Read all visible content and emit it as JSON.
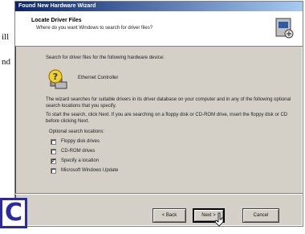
{
  "page_fragments": [
    "ill",
    "nd"
  ],
  "dialog": {
    "title": "Found New Hardware Wizard",
    "header_title": "Locate Driver Files",
    "header_subtitle": "Where do you want Windows to search for driver files?",
    "header_icon": "hardware-wizard-icon",
    "intro": "Search for driver files for the following hardware device:",
    "device_icon": "question-device-icon",
    "device_name": "Ethernet Controller",
    "paragraph1": "The wizard searches for suitable drivers in its driver database on your computer and in any of the following optional search locations that you specify.",
    "paragraph2": "To start the search, click Next. If you are searching on a floppy disk or CD-ROM drive, insert the floppy disk or CD before clicking Next.",
    "options_label": "Optional search locations:",
    "options": [
      {
        "label": "Floppy disk drives",
        "checked": false
      },
      {
        "label": "CD-ROM drives",
        "checked": false
      },
      {
        "label": "Specify a location",
        "checked": true
      },
      {
        "label": "Microsoft Windows Update",
        "checked": false
      }
    ],
    "buttons": {
      "back": "< Back",
      "next": "Next >",
      "cancel": "Cancel"
    }
  },
  "badge_letter": "C",
  "colors": {
    "dialog_bg": "#d4d0c8",
    "title_start": "#0a246a",
    "title_end": "#a6caf0",
    "badge": "#2c2a9e"
  }
}
